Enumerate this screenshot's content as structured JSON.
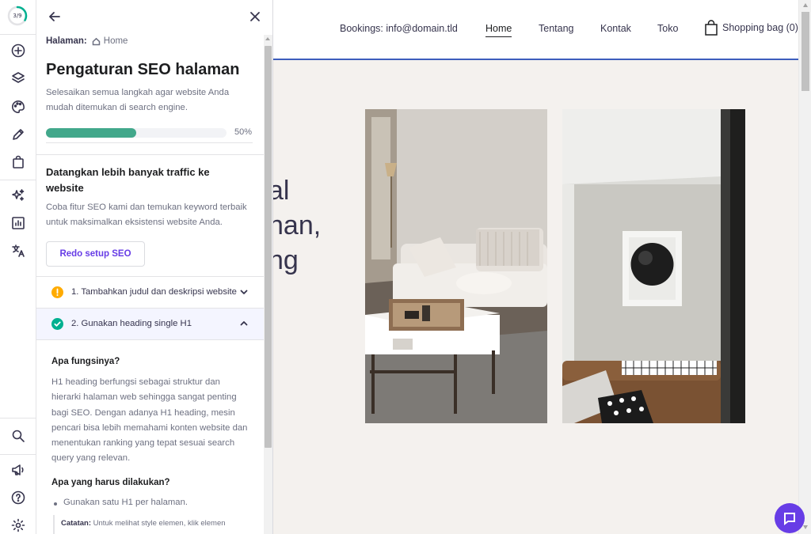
{
  "rail": {
    "progress_text": "3/9",
    "progress_fraction": 0.333,
    "icons": [
      "progress-ring",
      "add-element-icon",
      "layers-icon",
      "palette-icon",
      "pencil-icon",
      "shopping-bag-icon",
      "ai-sparkle-icon",
      "analytics-icon",
      "translate-icon",
      "search-icon",
      "megaphone-icon",
      "help-icon",
      "settings-icon"
    ]
  },
  "panel": {
    "breadcrumb_label": "Halaman:",
    "breadcrumb_page": "Home",
    "title": "Pengaturan SEO halaman",
    "subtitle": "Selesaikan semua langkah agar website Anda mudah ditemukan di search engine.",
    "progress_fraction": 0.5,
    "progress_text": "50%",
    "traffic_title": "Datangkan lebih banyak traffic ke website",
    "traffic_text": "Coba fitur SEO kami dan temukan keyword terbaik untuk maksimalkan eksistensi website Anda.",
    "redo_button": "Redo setup SEO",
    "steps": [
      {
        "label": "1. Tambahkan judul dan deskripsi website",
        "status": "warning",
        "expanded": false
      },
      {
        "label": "2. Gunakan heading single H1",
        "status": "done",
        "expanded": true
      }
    ],
    "what_heading": "Apa fungsinya?",
    "what_text": "H1 heading berfungsi sebagai struktur dan hierarki halaman web sehingga sangat penting bagi SEO. Dengan adanya H1 heading, mesin pencari bisa lebih memahami konten website dan menentukan ranking yang tepat sesuai search query yang relevan.",
    "todo_heading": "Apa yang harus dilakukan?",
    "todo_bullet": "Gunakan satu H1 per halaman.",
    "note_label": "Catatan:",
    "note_text": "Untuk melihat style elemen, klik elemen"
  },
  "site": {
    "nav": {
      "bookings": "Bookings: info@domain.tld",
      "home": "Home",
      "about": "Tentang",
      "contact": "Kontak",
      "shop": "Toko",
      "bag": "Shopping bag (0)"
    },
    "hero_text": "al\nnan,\nng"
  },
  "colors": {
    "accent": "#673de6",
    "progress": "#42a88b",
    "warning": "#ffab00",
    "success": "#00b090",
    "header_line": "#3d5dbd"
  }
}
